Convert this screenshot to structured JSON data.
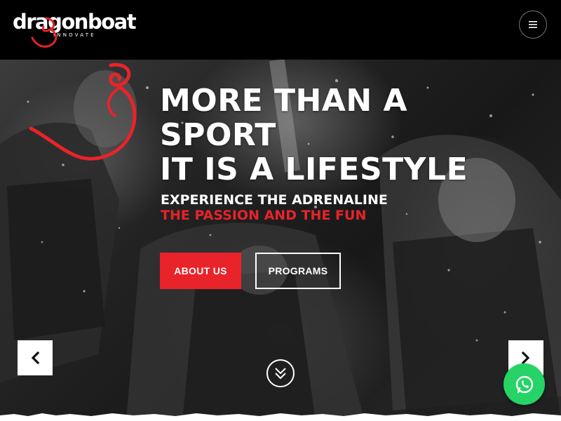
{
  "header": {
    "logo": {
      "wordmark": "dragonboat",
      "tagline": "INNOVATE",
      "icon": "dragon-logo-icon"
    },
    "menu_icon": "hamburger-menu-icon"
  },
  "hero": {
    "headline_lines": [
      "MORE THAN A",
      "SPORT",
      "IT IS A LIFESTYLE"
    ],
    "subtitle_line1": "EXPERIENCE THE ADRENALINE",
    "subtitle_line2": "THE PASSION AND THE FUN",
    "buttons": {
      "about": "ABOUT US",
      "programs": "PROGRAMS"
    },
    "prev_icon": "chevron-left-icon",
    "next_icon": "chevron-right-icon",
    "scroll_icon": "double-chevron-down-icon"
  },
  "floating": {
    "whatsapp_icon": "whatsapp-icon"
  },
  "colors": {
    "accent_red": "#e8232a",
    "whatsapp_green": "#25d366",
    "header_bg": "#000000"
  }
}
